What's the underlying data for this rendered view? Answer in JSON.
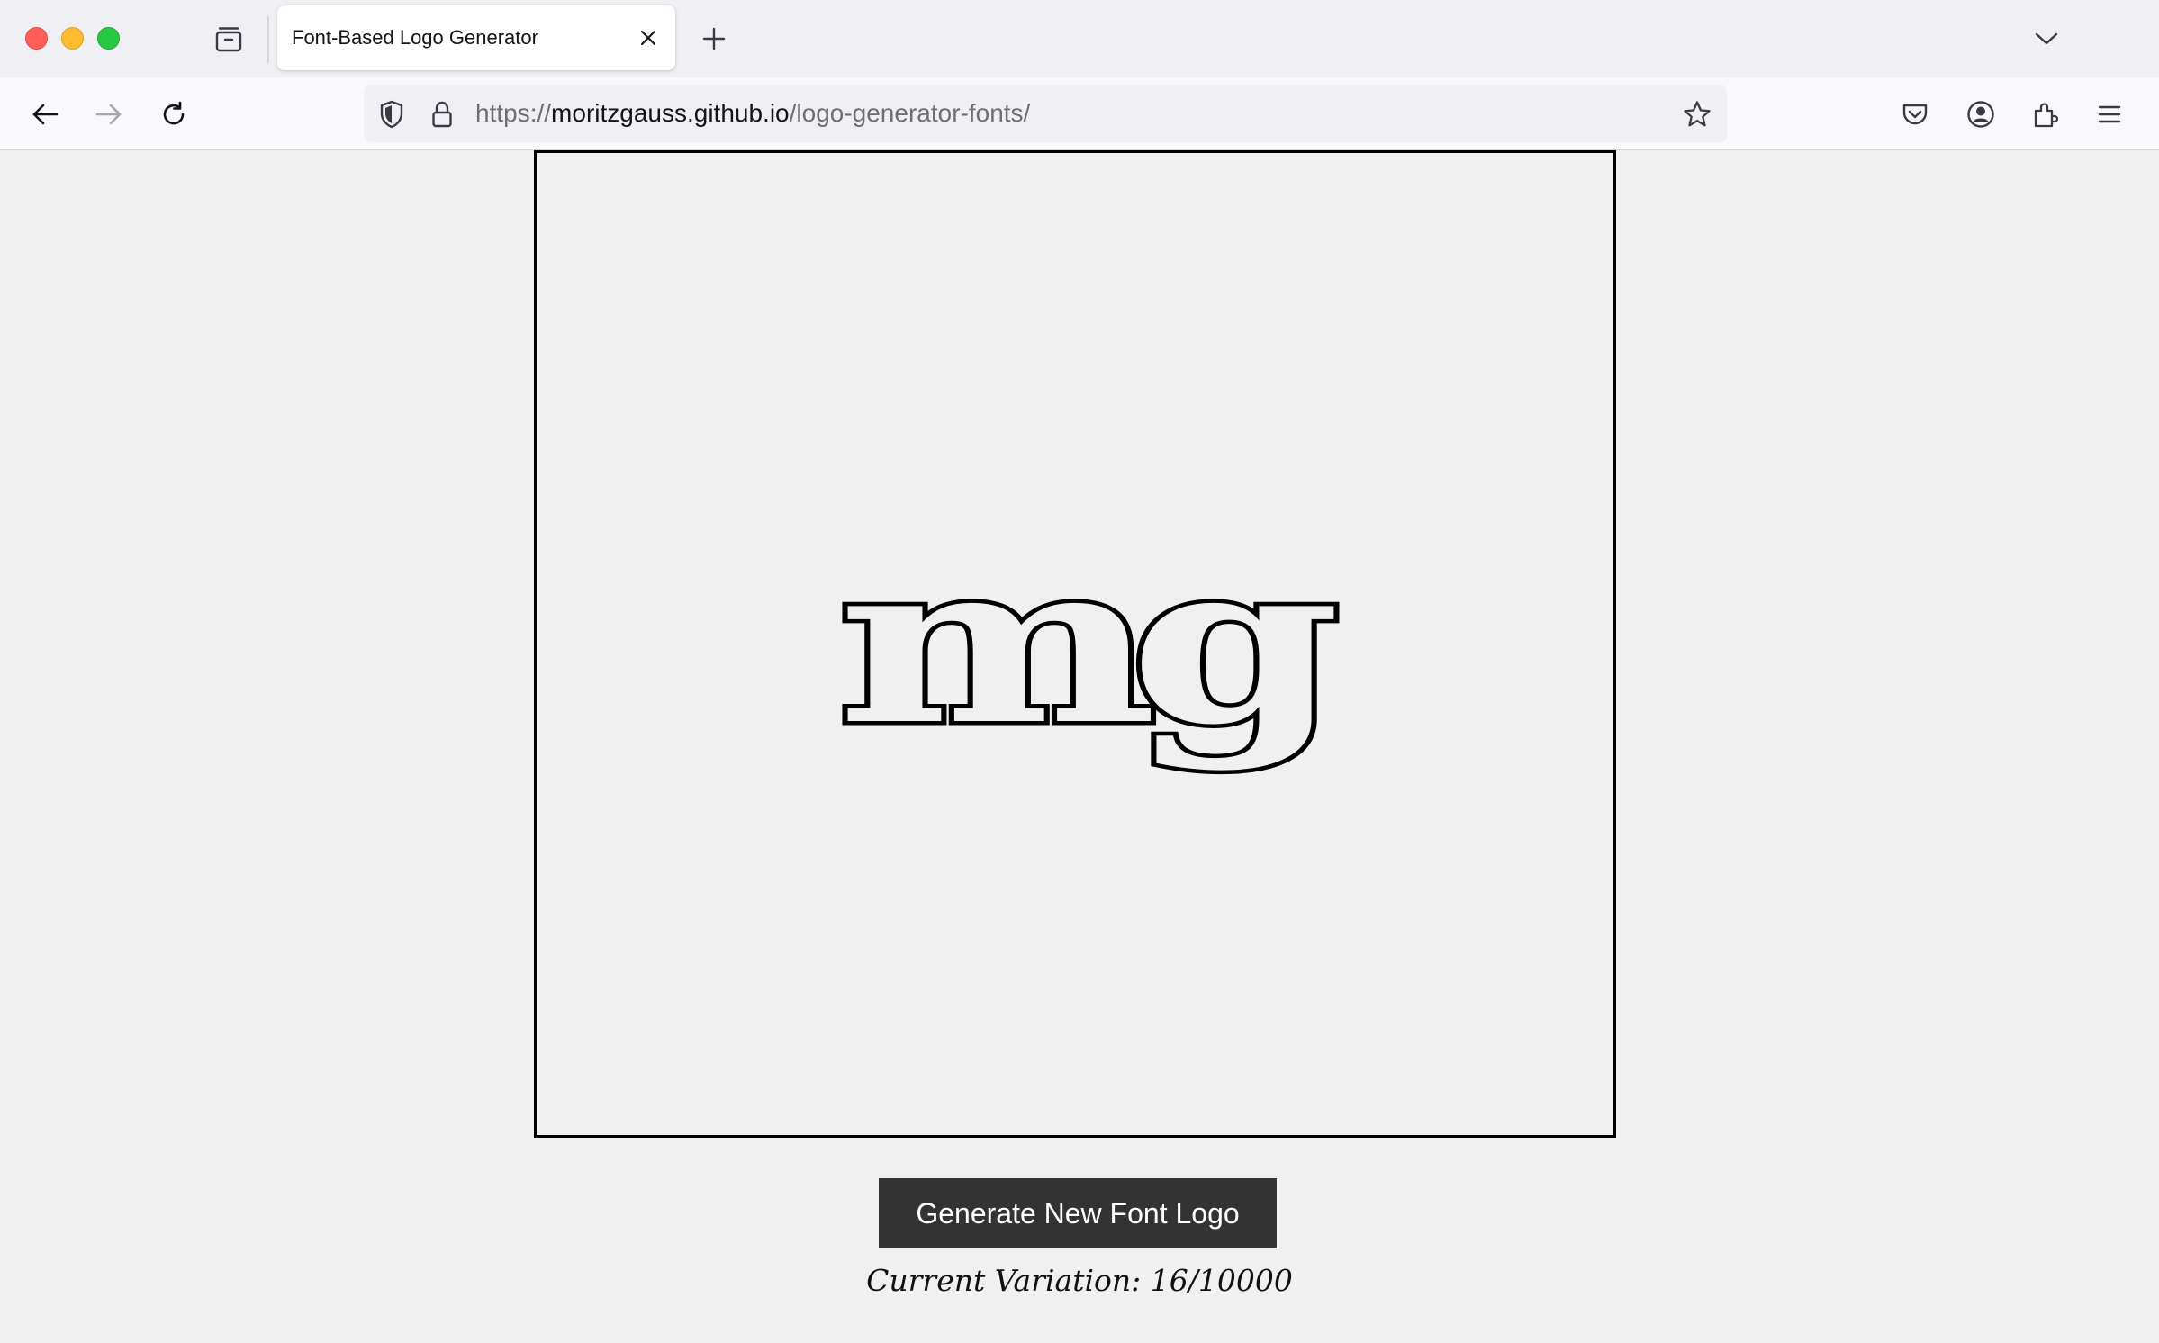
{
  "browser": {
    "tab": {
      "title": "Font-Based Logo Generator"
    },
    "url": {
      "scheme": "https://",
      "host": "moritzgauss.github.io",
      "path": "/logo-generator-fonts/"
    },
    "icons": {
      "tab_overview": "tab-overview-icon",
      "close_tab": "close-icon",
      "new_tab": "plus-icon",
      "tab_list": "chevron-down-icon",
      "back": "back-arrow-icon",
      "forward": "forward-arrow-icon",
      "reload": "reload-icon",
      "tracking_protection": "shield-icon",
      "secure": "lock-icon",
      "bookmark": "star-icon",
      "pocket": "pocket-icon",
      "account": "account-icon",
      "extensions": "puzzle-icon",
      "menu": "hamburger-menu-icon"
    },
    "colors": {
      "close": "#ff5f57",
      "minimize": "#febc2e",
      "maximize": "#28c840"
    }
  },
  "page": {
    "logo_text": "mg",
    "button_label": "Generate New Font Logo",
    "variation_text": "Current Variation: 16/10000",
    "colors": {
      "background": "#f0f0f0",
      "canvas_border": "#000000",
      "button_bg": "#333333",
      "button_text": "#ffffff"
    }
  }
}
